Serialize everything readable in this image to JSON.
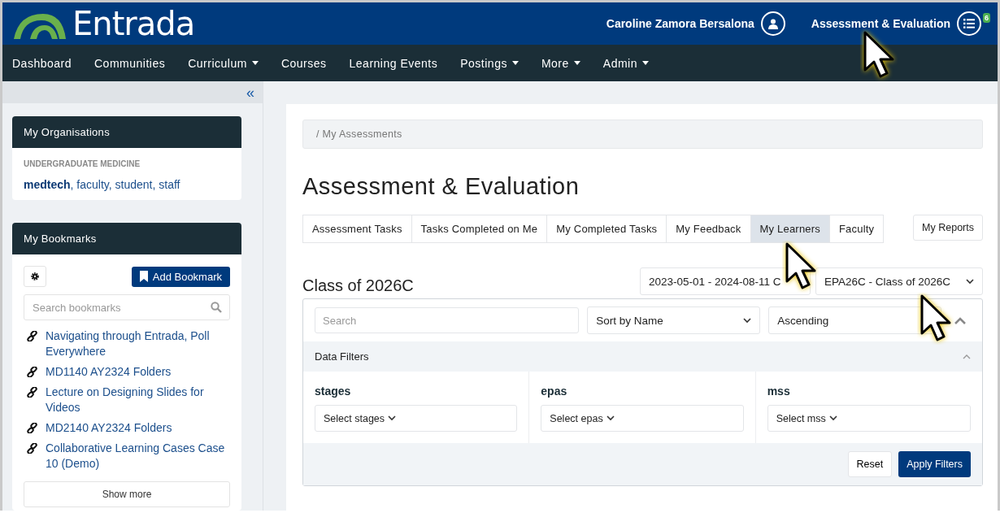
{
  "header": {
    "logo_text": "Entrada",
    "user_name": "Caroline Zamora Bersalona",
    "app_name": "Assessment & Evaluation",
    "badge": "6"
  },
  "nav": [
    {
      "label": "Dashboard",
      "dropdown": false
    },
    {
      "label": "Communities",
      "dropdown": false
    },
    {
      "label": "Curriculum",
      "dropdown": true
    },
    {
      "label": "Courses",
      "dropdown": false
    },
    {
      "label": "Learning Events",
      "dropdown": false
    },
    {
      "label": "Postings",
      "dropdown": true
    },
    {
      "label": "More",
      "dropdown": true
    },
    {
      "label": "Admin",
      "dropdown": true
    }
  ],
  "sidebar": {
    "collapse": "«",
    "organisations": {
      "title": "My Organisations",
      "category": "UNDERGRADUATE MEDICINE",
      "groups": "**medtech**, faculty, student, staff"
    },
    "bookmarks": {
      "title": "My Bookmarks",
      "add_button": "Add Bookmark",
      "search": {
        "placeholder": "Search bookmarks"
      },
      "items": [
        "Navigating through Entrada, Poll Everywhere",
        "MD1140 AY2324 Folders",
        "Lecture on Designing Slides for Videos",
        "MD2140 AY2324 Folders",
        "Collaborative Learning Cases Case 10 (Demo)"
      ],
      "show_more": "Show more"
    }
  },
  "main": {
    "breadcrumb": "/ My Assessments",
    "title": "Assessment & Evaluation",
    "tabs": [
      {
        "label": "Assessment Tasks",
        "selected": false
      },
      {
        "label": "Tasks Completed on Me",
        "selected": false
      },
      {
        "label": "My Completed Tasks",
        "selected": false
      },
      {
        "label": "My Feedback",
        "selected": false
      },
      {
        "label": "My Learners",
        "selected": true
      },
      {
        "label": "Faculty",
        "selected": false
      }
    ],
    "reports_button": "My Reports",
    "class_title": "Class of 2026C",
    "date_select": "2023-05-01 - 2024-08-11 C",
    "class_select": "EPA26C - Class of 2026C",
    "search": {
      "placeholder": "Search"
    },
    "sort": "Sort by Name",
    "order": "Ascending",
    "filters": {
      "title": "Data Filters",
      "groups": [
        {
          "label": "stages",
          "placeholder": "Select stages"
        },
        {
          "label": "epas",
          "placeholder": "Select epas"
        },
        {
          "label": "mss",
          "placeholder": "Select mss"
        }
      ],
      "reset": "Reset",
      "apply": "Apply Filters"
    }
  }
}
